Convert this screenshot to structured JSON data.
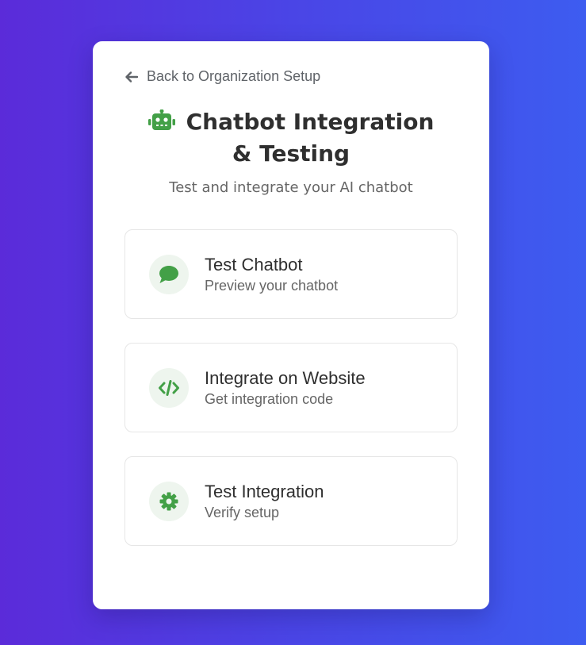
{
  "back_link": {
    "label": "Back to Organization Setup",
    "icon": "arrow-left-icon"
  },
  "header": {
    "title": "Chatbot Integration & Testing",
    "subtitle": "Test and integrate your AI chatbot",
    "icon": "robot-icon"
  },
  "options": [
    {
      "title": "Test Chatbot",
      "description": "Preview your chatbot",
      "icon": "comment-icon"
    },
    {
      "title": "Integrate on Website",
      "description": "Get integration code",
      "icon": "code-icon"
    },
    {
      "title": "Test Integration",
      "description": "Verify setup",
      "icon": "gear-icon"
    }
  ],
  "colors": {
    "accent": "#43a047",
    "icon_bg": "#eef5ee",
    "background_start": "#5b2bd9",
    "background_end": "#3d5cf0"
  }
}
